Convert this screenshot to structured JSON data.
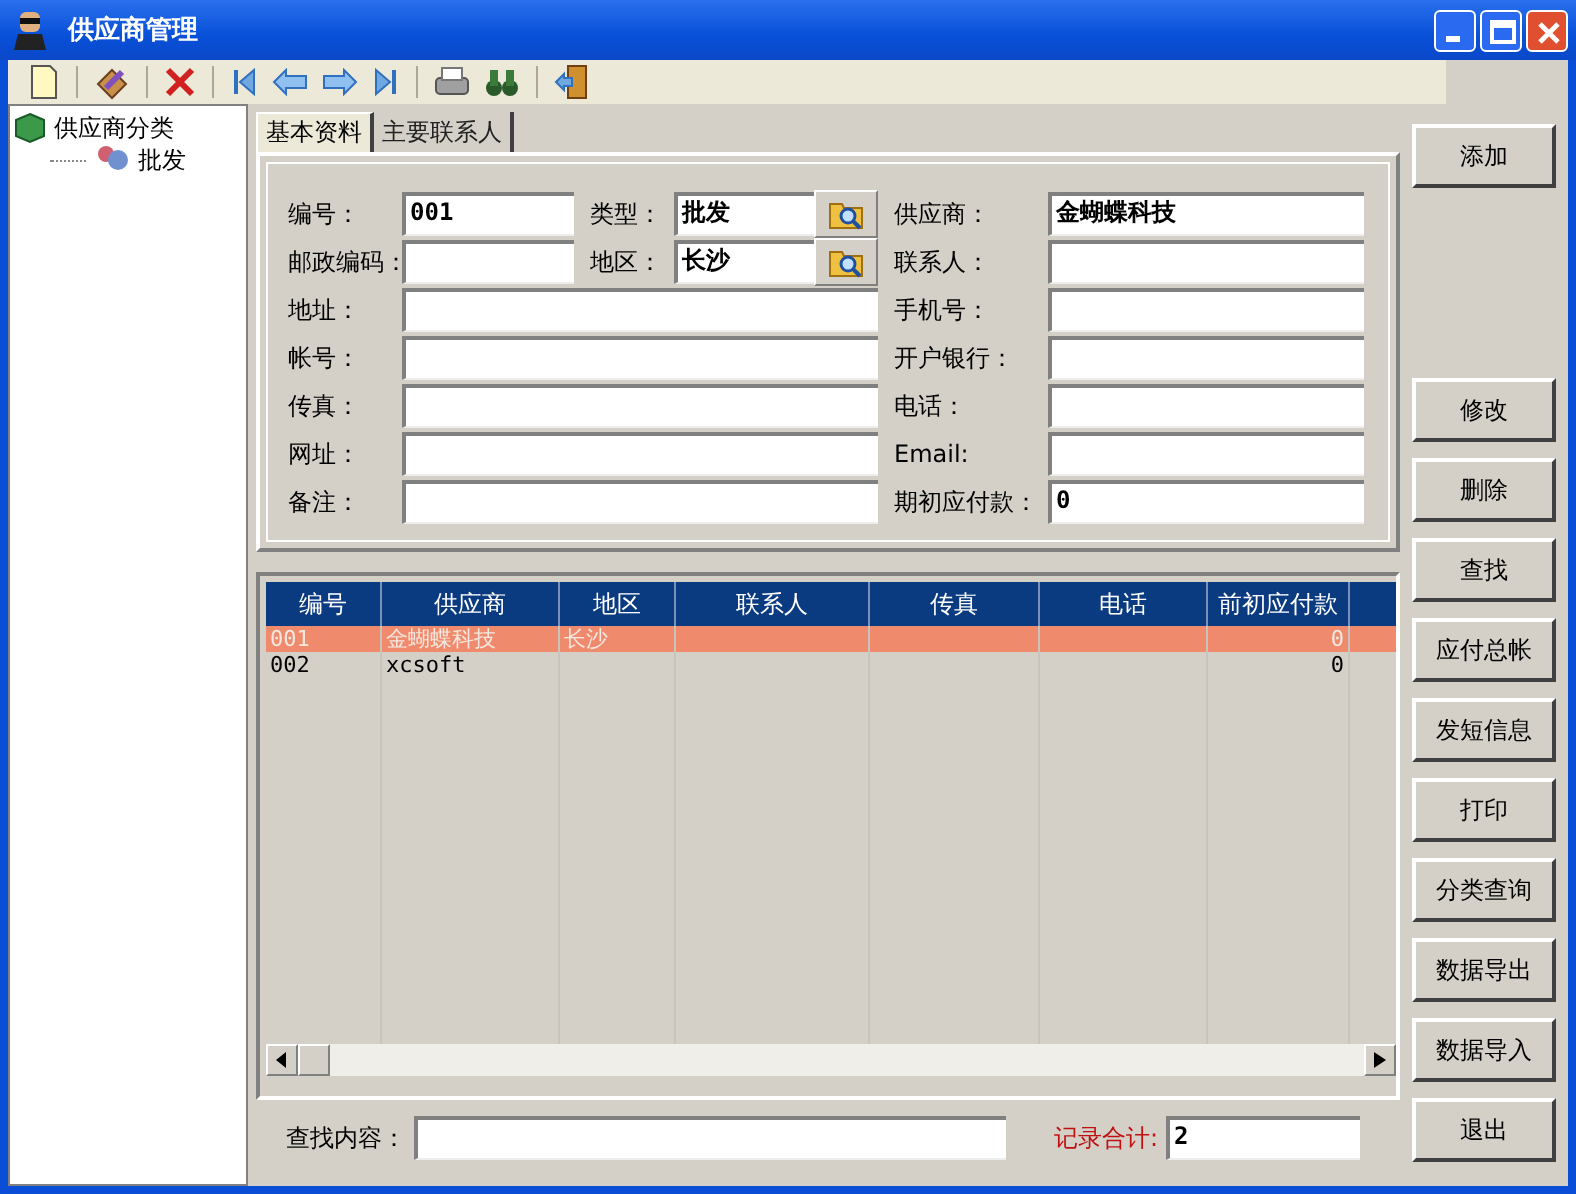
{
  "window": {
    "title": "供应商管理"
  },
  "tree": {
    "label": "供应商分类",
    "children": [
      {
        "label": "批发"
      }
    ]
  },
  "tabs": [
    {
      "label": "基本资料",
      "selected": true
    },
    {
      "label": "主要联系人",
      "selected": false
    }
  ],
  "form": {
    "fields": [
      {
        "kind": "short",
        "label": "编号：",
        "value": "001"
      },
      {
        "kind": "lookup",
        "label": "类型：",
        "value": "批发"
      },
      {
        "kind": "right",
        "label": "供应商：",
        "value": "金蝴蝶科技"
      },
      {
        "kind": "short",
        "label": "邮政编码："
      },
      {
        "kind": "lookup",
        "label": "地区：",
        "value": "长沙"
      },
      {
        "kind": "right",
        "label": "联系人："
      },
      {
        "kind": "wide",
        "label": "地址："
      },
      {
        "kind": "right",
        "label": "手机号："
      },
      {
        "kind": "wide",
        "label": "帐号："
      },
      {
        "kind": "right",
        "label": "开户银行："
      },
      {
        "kind": "wide",
        "label": "传真："
      },
      {
        "kind": "right",
        "label": "电话："
      },
      {
        "kind": "wide",
        "label": "网址："
      },
      {
        "kind": "right",
        "label": "Email:"
      },
      {
        "kind": "wide",
        "label": "备注："
      },
      {
        "kind": "right",
        "label": "期初应付款：",
        "value": "0"
      }
    ]
  },
  "table": {
    "columns": [
      "编号",
      "供应商",
      "地区",
      "联系人",
      "传真",
      "电话",
      "前初应付款"
    ],
    "rows": [
      {
        "selected": true,
        "cells": [
          "001",
          "金蝴蝶科技",
          "长沙",
          null,
          null,
          null,
          "0"
        ]
      },
      {
        "selected": false,
        "cells": [
          "002",
          "xcsoft",
          null,
          null,
          null,
          null,
          "0"
        ]
      }
    ]
  },
  "search": {
    "label": "查找内容："
  },
  "record_total": {
    "label": "记录合计:",
    "value": "2"
  },
  "buttons": [
    "添加",
    "修改",
    "删除",
    "查找",
    "应付总帐",
    "发短信息",
    "打印",
    "分类查询",
    "数据导出",
    "数据导入",
    "退出"
  ]
}
